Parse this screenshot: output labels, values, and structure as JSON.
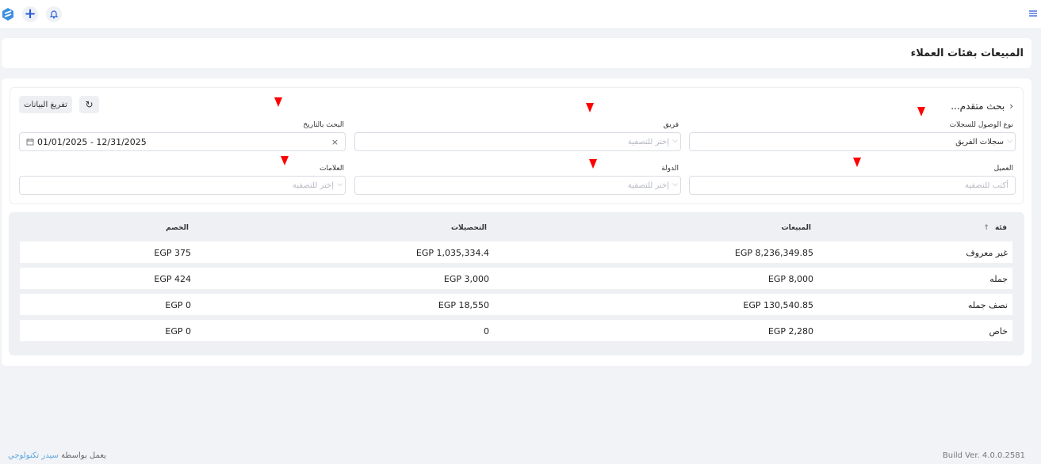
{
  "header": {
    "logo_icon": "logo-icon",
    "add_icon": "plus-icon",
    "notifications_icon": "bell-icon",
    "menu_icon": "hamburger-icon"
  },
  "page": {
    "title": "المبيعات بفئات العملاء"
  },
  "filters": {
    "advanced_toggle": "بحث متقدم...",
    "export_label": "تفريغ البيانات",
    "refresh_icon": "refresh-icon",
    "access_type": {
      "label": "نوع الوصول للسجلات",
      "value": "سجلات الفريق"
    },
    "team": {
      "label": "فريق",
      "placeholder": "إختر للتصفية"
    },
    "date": {
      "label": "البحث بالتاريخ",
      "value": "01/01/2025 - 12/31/2025"
    },
    "client": {
      "label": "العميل",
      "placeholder": "أكتب للتصفية"
    },
    "country": {
      "label": "الدولة",
      "placeholder": "إختر للتصفية"
    },
    "tags": {
      "label": "العلامات",
      "placeholder": "إختر للتصفية"
    }
  },
  "table": {
    "columns": {
      "category": "فئة",
      "sales": "المبيعات",
      "collections": "التحصيلات",
      "discount": "الخصم"
    },
    "rows": [
      {
        "category": "غير معروف",
        "sales": "EGP 8,236,349.85",
        "collections": "EGP 1,035,334.4",
        "discount": "EGP 375"
      },
      {
        "category": "جمله",
        "sales": "EGP 8,000",
        "collections": "EGP 3,000",
        "discount": "EGP 424"
      },
      {
        "category": "نصف جمله",
        "sales": "EGP 130,540.85",
        "collections": "EGP 18,550",
        "discount": "EGP 0"
      },
      {
        "category": "خاص",
        "sales": "EGP 2,280",
        "collections": "0",
        "discount": "EGP 0"
      }
    ]
  },
  "footer": {
    "powered_by": "يعمل بواسطة",
    "brand": "سيدر تكنولوجي",
    "build": "Build Ver. 4.0.0.2581"
  },
  "colors": {
    "accent": "#2a5bd7",
    "marker": "#ff0000",
    "brand_link": "#5aa7e0"
  }
}
